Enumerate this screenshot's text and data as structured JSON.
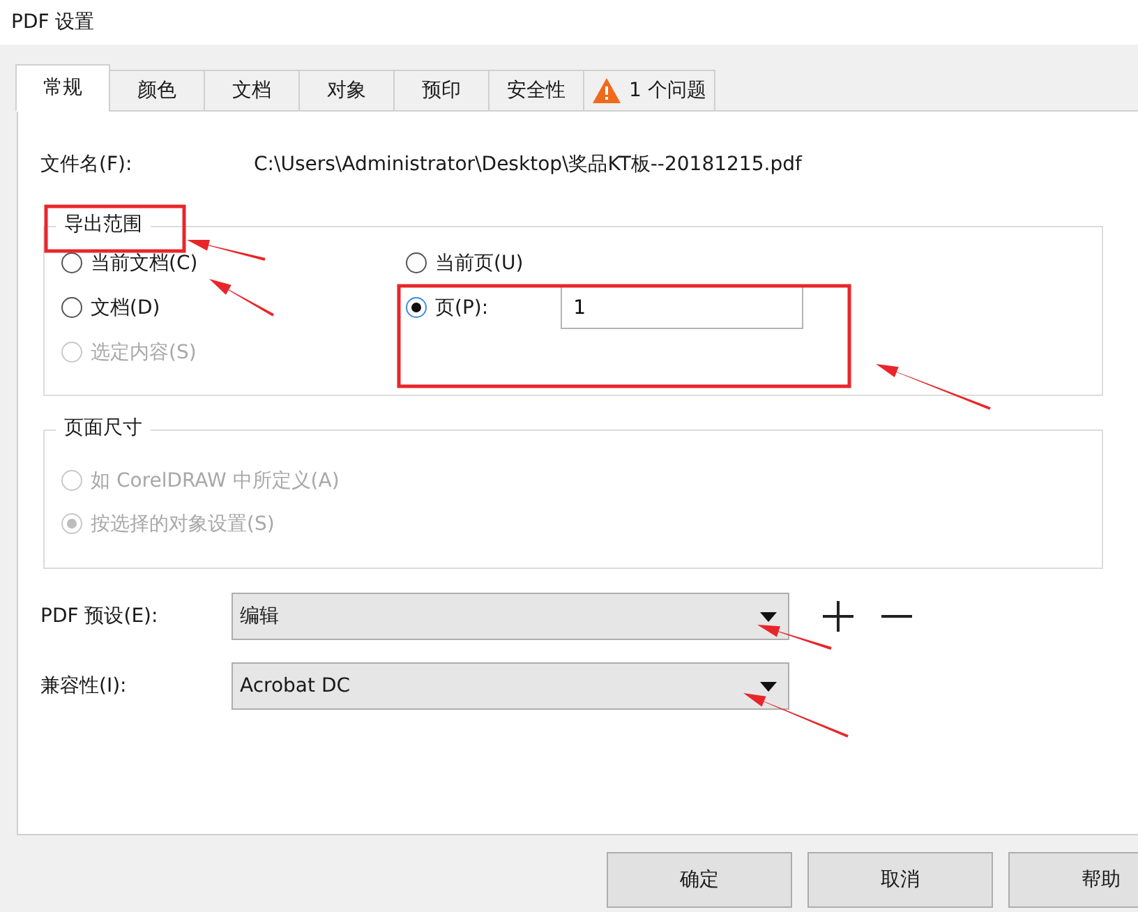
{
  "window": {
    "title": "PDF 设置"
  },
  "tabs": [
    {
      "label": "常规",
      "selected": true,
      "kind": "plain"
    },
    {
      "label": "颜色",
      "selected": false,
      "kind": "plain"
    },
    {
      "label": "文档",
      "selected": false,
      "kind": "plain"
    },
    {
      "label": "对象",
      "selected": false,
      "kind": "plain"
    },
    {
      "label": "预印",
      "selected": false,
      "kind": "plain"
    },
    {
      "label": "安全性",
      "selected": false,
      "kind": "plain"
    },
    {
      "label": "1 个问题",
      "selected": false,
      "kind": "warning"
    }
  ],
  "file_name": {
    "label": "文件名(F):",
    "value": "C:\\Users\\Administrator\\Desktop\\奖品KT板--20181215.pdf"
  },
  "export_range": {
    "title": "导出范围",
    "left_options": [
      {
        "label": "当前文档(C)",
        "selected": false,
        "disabled": false
      },
      {
        "label": "文档(D)",
        "selected": false,
        "disabled": false
      },
      {
        "label": "选定内容(S)",
        "selected": false,
        "disabled": true
      }
    ],
    "right_options": [
      {
        "label": "当前页(U)",
        "selected": false,
        "disabled": false
      },
      {
        "label": "页(P):",
        "selected": true,
        "disabled": false
      }
    ],
    "pages_value": "1"
  },
  "page_size": {
    "title": "页面尺寸",
    "options": [
      {
        "label": "如 CorelDRAW 中所定义(A)",
        "selected": false,
        "disabled": true
      },
      {
        "label": "按选择的对象设置(S)",
        "selected": true,
        "disabled": true
      }
    ]
  },
  "pdf_preset": {
    "label": "PDF 预设(E):",
    "value": "编辑"
  },
  "compatibility": {
    "label": "兼容性(I):",
    "value": "Acrobat DC"
  },
  "buttons": [
    {
      "label": "确定"
    },
    {
      "label": "取消"
    },
    {
      "label": "帮助"
    }
  ]
}
